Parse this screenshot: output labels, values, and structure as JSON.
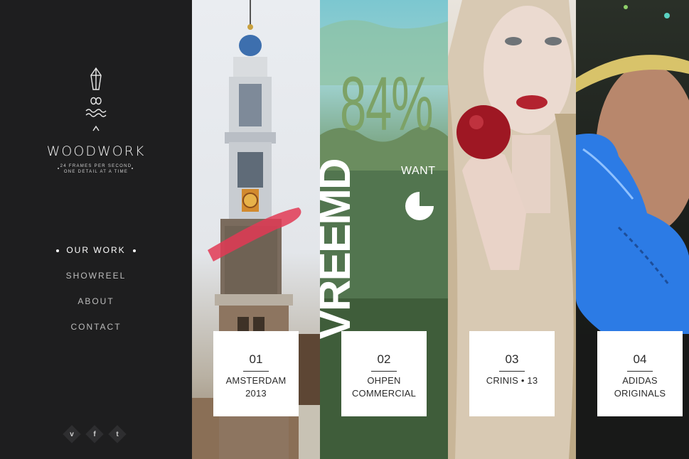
{
  "brand": {
    "name": "WOODWORK",
    "tagline_1": "24 FRAMES PER SECOND",
    "tagline_2": "ONE DETAIL AT A TIME"
  },
  "nav": [
    {
      "label": "OUR WORK",
      "active": true
    },
    {
      "label": "SHOWREEL",
      "active": false
    },
    {
      "label": "ABOUT",
      "active": false
    },
    {
      "label": "CONTACT",
      "active": false
    }
  ],
  "socials": [
    {
      "icon": "vimeo-icon",
      "glyph": "v"
    },
    {
      "icon": "facebook-icon",
      "glyph": "f"
    },
    {
      "icon": "twitter-icon",
      "glyph": "t"
    }
  ],
  "projects": [
    {
      "number": "01",
      "title_line1": "AMSTERDAM",
      "title_line2": "2013"
    },
    {
      "number": "02",
      "title_line1": "OHPEN",
      "title_line2": "COMMERCIAL",
      "image_text": {
        "big": "84%",
        "word": "WANT",
        "vertical": "VREEMD"
      }
    },
    {
      "number": "03",
      "title_line1": "CRINIS • 13",
      "title_line2": ""
    },
    {
      "number": "04",
      "title_line1": "ADIDAS",
      "title_line2": "ORIGINALS"
    }
  ],
  "colors": {
    "sidebar": "#1e1e1f",
    "card": "#ffffff",
    "accent_green": "#7da266"
  }
}
